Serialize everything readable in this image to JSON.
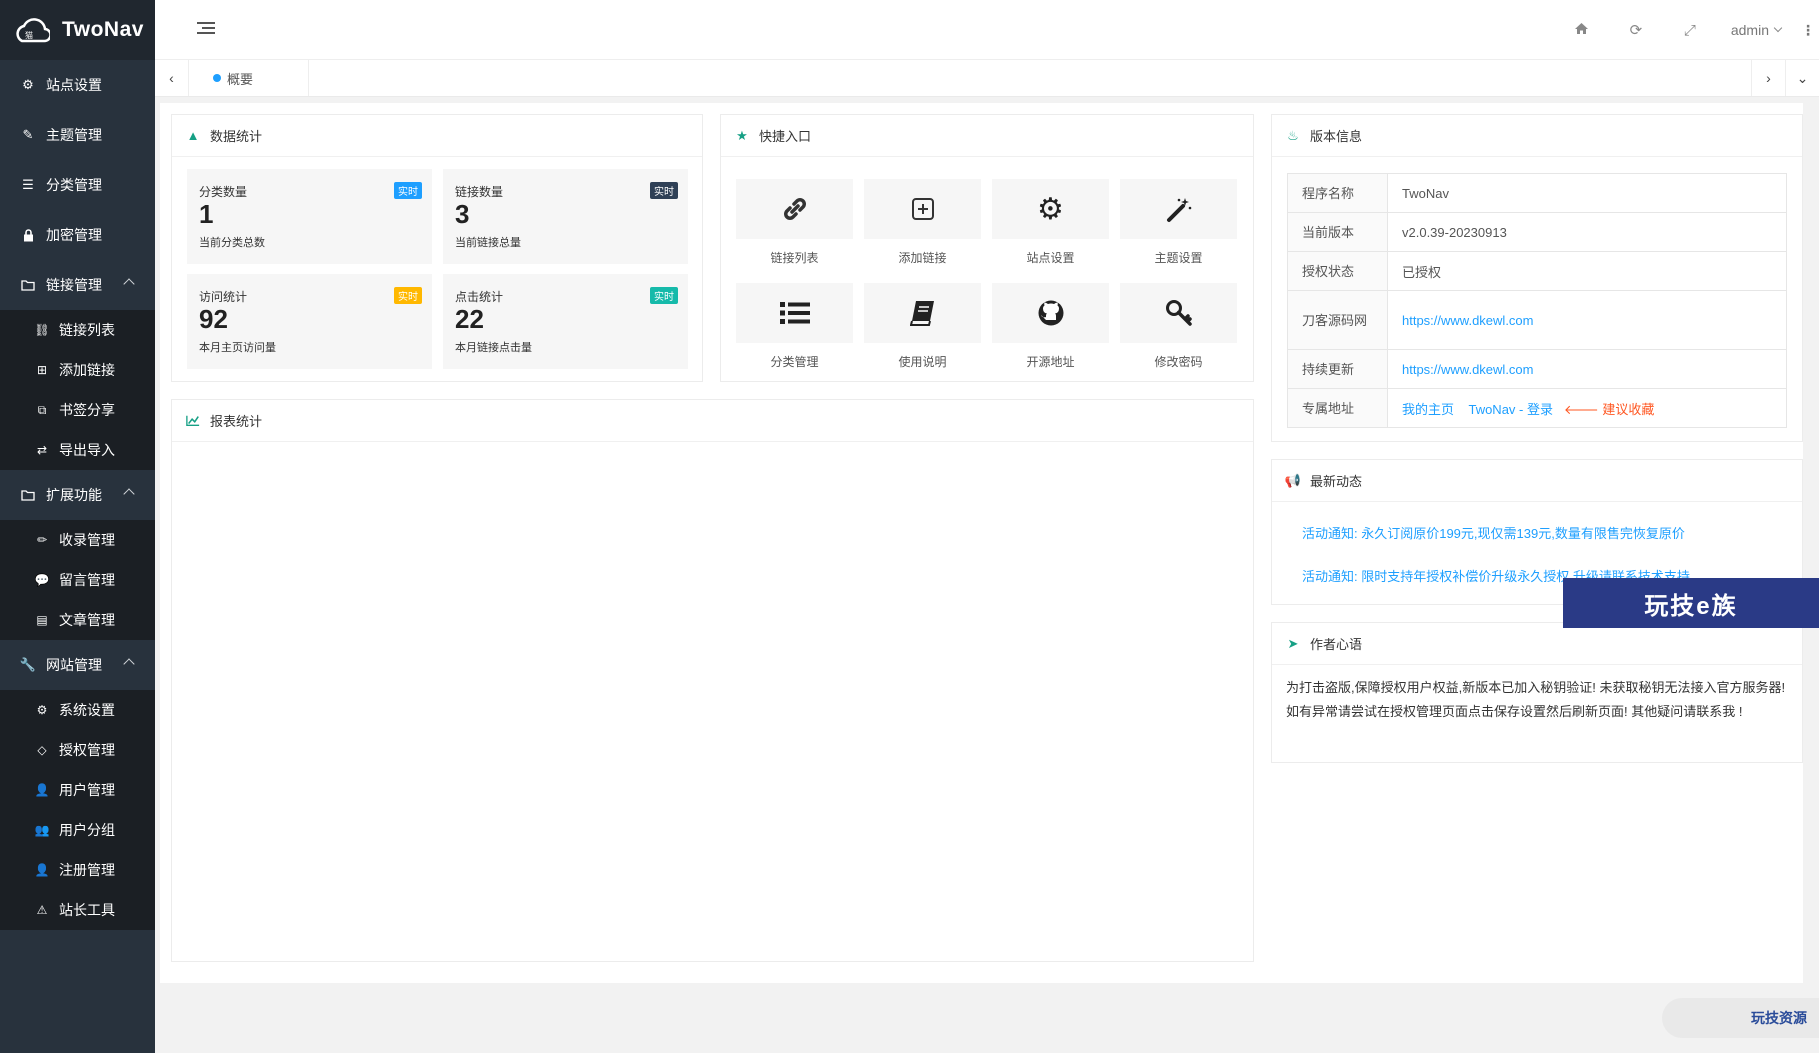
{
  "app": {
    "title": "TwoNav"
  },
  "sidebar": {
    "items": [
      {
        "label": "站点设置",
        "icon": "gear-icon"
      },
      {
        "label": "主题管理",
        "icon": "wand-icon"
      },
      {
        "label": "分类管理",
        "icon": "list-icon"
      },
      {
        "label": "加密管理",
        "icon": "lock-icon"
      },
      {
        "label": "链接管理",
        "icon": "folder-icon"
      },
      {
        "label": "扩展功能",
        "icon": "folder-icon"
      },
      {
        "label": "网站管理",
        "icon": "wrench-icon"
      }
    ],
    "links_sub": [
      {
        "label": "链接列表",
        "icon": "link-icon"
      },
      {
        "label": "添加链接",
        "icon": "plus-square-icon"
      },
      {
        "label": "书签分享",
        "icon": "external-link-icon"
      },
      {
        "label": "导出导入",
        "icon": "retweet-icon"
      }
    ],
    "ext_sub": [
      {
        "label": "收录管理",
        "icon": "pencil-icon"
      },
      {
        "label": "留言管理",
        "icon": "comment-icon"
      },
      {
        "label": "文章管理",
        "icon": "document-icon"
      }
    ],
    "site_sub": [
      {
        "label": "系统设置",
        "icon": "cogs-icon"
      },
      {
        "label": "授权管理",
        "icon": "diamond-icon"
      },
      {
        "label": "用户管理",
        "icon": "user-icon"
      },
      {
        "label": "用户分组",
        "icon": "users-icon"
      },
      {
        "label": "注册管理",
        "icon": "user-plus-icon"
      },
      {
        "label": "站长工具",
        "icon": "warning-icon"
      }
    ]
  },
  "header": {
    "user": "admin"
  },
  "tabs": {
    "active": "概要"
  },
  "stats": {
    "title": "数据统计",
    "cards": [
      {
        "title": "分类数量",
        "value": "1",
        "desc": "当前分类总数",
        "badge": "实时",
        "badge_color": "#1e9fff"
      },
      {
        "title": "链接数量",
        "value": "3",
        "desc": "当前链接总量",
        "badge": "实时",
        "badge_color": "#2f4056"
      },
      {
        "title": "访问统计",
        "value": "92",
        "desc": "本月主页访问量",
        "badge": "实时",
        "badge_color": "#ffb800"
      },
      {
        "title": "点击统计",
        "value": "22",
        "desc": "本月链接点击量",
        "badge": "实时",
        "badge_color": "#16baaa"
      }
    ]
  },
  "quick": {
    "title": "快捷入口",
    "items": [
      {
        "label": "链接列表",
        "icon": "link-icon"
      },
      {
        "label": "添加链接",
        "icon": "plus-square-icon"
      },
      {
        "label": "站点设置",
        "icon": "gear-icon"
      },
      {
        "label": "主题设置",
        "icon": "magic-wand-icon"
      },
      {
        "label": "分类管理",
        "icon": "list-icon"
      },
      {
        "label": "使用说明",
        "icon": "book-icon"
      },
      {
        "label": "开源地址",
        "icon": "github-icon"
      },
      {
        "label": "修改密码",
        "icon": "key-icon"
      }
    ]
  },
  "report": {
    "title": "报表统计"
  },
  "version": {
    "title": "版本信息",
    "rows": [
      {
        "k": "程序名称",
        "v": "TwoNav"
      },
      {
        "k": "当前版本",
        "v": "v2.0.39-20230913"
      },
      {
        "k": "授权状态",
        "v": "已授权"
      },
      {
        "k": "刀客源码网",
        "v": "https://www.dkewl.com"
      },
      {
        "k": "持续更新",
        "v": "https://www.dkewl.com"
      },
      {
        "k": "专属地址",
        "links": [
          "我的主页",
          "TwoNav - 登录",
          "建议收藏"
        ]
      }
    ]
  },
  "news": {
    "title": "最新动态",
    "items": [
      "活动通知: 永久订阅原价199元,现仅需139元,数量有限售完恢复原价",
      "活动通知: 限时支持年授权补偿价升级永久授权,升级请联系技术支持"
    ]
  },
  "author": {
    "title": "作者心语",
    "lines": [
      "为打击盗版,保障授权用户权益,新版本已加入秘钥验证! 未获取秘钥无法接入官方服务器!",
      "如有异常请尝试在授权管理页面点击保存设置然后刷新页面! 其他疑问请联系我 !"
    ]
  },
  "watermark": "玩技e族",
  "corner_badge": "玩技资源"
}
